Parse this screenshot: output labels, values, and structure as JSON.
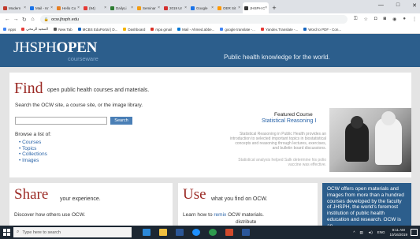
{
  "browser": {
    "tabs": [
      {
        "label": "Modern",
        "color": "#c0392b"
      },
      {
        "label": "Mail - Kr",
        "color": "#1a73e8"
      },
      {
        "label": "Hello Co",
        "color": "#e67e22"
      },
      {
        "label": "(94)",
        "color": "#e53935"
      },
      {
        "label": "DailyLi",
        "color": "#2e7d32"
      },
      {
        "label": "Seminar",
        "color": "#f39c12"
      },
      {
        "label": "2019 Ur",
        "color": "#d32f2f"
      },
      {
        "label": "Google",
        "color": "#1a73e8"
      },
      {
        "label": "OER Sit",
        "color": "#ff9800"
      },
      {
        "label": "JHSPH C",
        "color": "#333333"
      }
    ],
    "new_tab_symbol": "+",
    "url": "ocw.jhsph.edu",
    "bookmarks": [
      {
        "label": "Apps",
        "color": "#4285f4"
      },
      {
        "label": "السعيد الرمحي",
        "color": "#e53935"
      },
      {
        "label": "New Tab",
        "color": "#555555"
      },
      {
        "label": "MCBS EduPortal | D...",
        "color": "#1565c0"
      },
      {
        "label": "Dashboard",
        "color": "#f4b400"
      },
      {
        "label": "mpa gmail",
        "color": "#d93025"
      },
      {
        "label": "Mail - Ahmed.abbe...",
        "color": "#0078d4"
      },
      {
        "label": "google translate -...",
        "color": "#4285f4"
      },
      {
        "label": "Yandex.Translate -...",
        "color": "#e53935"
      },
      {
        "label": "Word to PDF - Con...",
        "color": "#1565c0"
      }
    ]
  },
  "header": {
    "logo_light": "JHSPH",
    "logo_bold": "OPEN",
    "logo_sub": "courseware",
    "tagline": "Public health knowledge for the world."
  },
  "find": {
    "title": "Find",
    "subtitle": "open public health courses and materials.",
    "search_prompt": "Search the OCW site, a course site, or the image library.",
    "search_button": "Search",
    "browse_label": "Browse a list of:",
    "browse_items": [
      "Courses",
      "Topics",
      "Collections",
      "Images"
    ],
    "featured_label": "Featured Course",
    "featured_title": "Statistical Reasoning I",
    "featured_desc": "Statistical Reasoning in Public Health provides an introduction to selected important topics in biostatistical concepts and reasoning through lectures, exercises, and bulletin board discussions.",
    "featured_note": "Statistical analysis helped Salk determine his polio vaccine was effective."
  },
  "share": {
    "title": "Share",
    "subtitle": "your experience.",
    "text": "Discover how others use OCW."
  },
  "use": {
    "title": "Use",
    "subtitle": "what you find on OCW.",
    "text_pre": "Learn how to ",
    "link": "remix",
    "text_post": " OCW materials.",
    "text2": "distribute"
  },
  "ocw_box": "OCW offers open materials and images from more than a hundred courses developed by the faculty of JHSPH, the world's foremost institution of public health education and research. OCW is an",
  "taskbar": {
    "search_placeholder": "Type here to search",
    "tray_lang": "ENG",
    "time": "9:11 AM",
    "date": "10/16/2019"
  }
}
